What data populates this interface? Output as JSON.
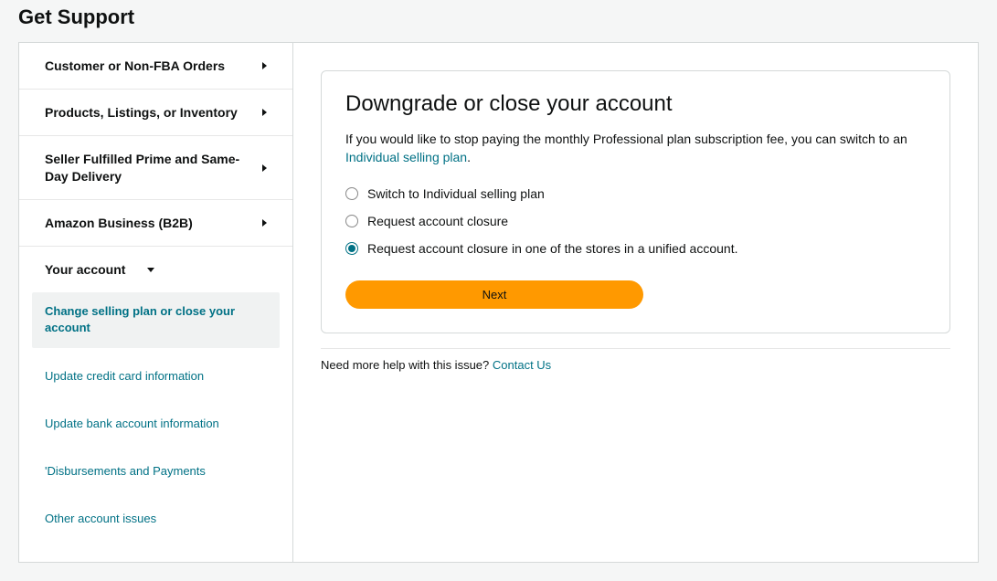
{
  "page": {
    "title": "Get Support"
  },
  "sidebar": {
    "items": [
      {
        "label": "Customer or Non-FBA Orders",
        "expanded": false
      },
      {
        "label": "Products, Listings, or Inventory",
        "expanded": false
      },
      {
        "label": "Seller Fulfilled Prime and Same-Day Delivery",
        "expanded": false
      },
      {
        "label": "Amazon Business (B2B)",
        "expanded": false
      },
      {
        "label": "Your account",
        "expanded": true
      }
    ],
    "sub_items": [
      {
        "label": "Change selling plan or close your account",
        "active": true
      },
      {
        "label": "Update credit card information",
        "active": false
      },
      {
        "label": "Update bank account information",
        "active": false
      },
      {
        "label": "'Disbursements and Payments",
        "active": false
      },
      {
        "label": "Other account issues",
        "active": false
      }
    ]
  },
  "main": {
    "card_title": "Downgrade or close your account",
    "desc_part1": "If you would like to stop paying the monthly Professional plan subscription fee, you can switch to an ",
    "desc_link": "Individual selling plan",
    "desc_part2": ".",
    "options": [
      {
        "label": "Switch to Individual selling plan",
        "checked": false
      },
      {
        "label": "Request account closure",
        "checked": false
      },
      {
        "label": "Request account closure in one of the stores in a unified account.",
        "checked": true
      }
    ],
    "next_label": "Next",
    "help_text": "Need more help with this issue?  ",
    "help_link": "Contact Us"
  }
}
